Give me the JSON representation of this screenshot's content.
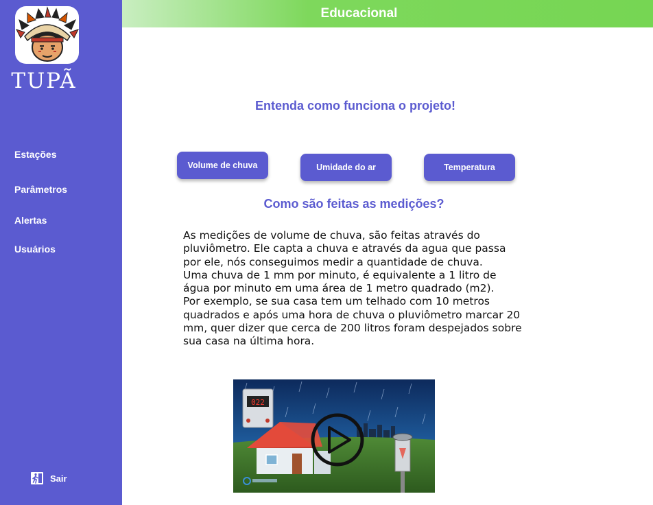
{
  "brand": {
    "name": "TUPÃ"
  },
  "sidebar": {
    "items": [
      {
        "label": "Estações"
      },
      {
        "label": "Parâmetros"
      },
      {
        "label": "Alertas"
      },
      {
        "label": "Usuários"
      }
    ],
    "logout_label": "Sair"
  },
  "header": {
    "title": "Educacional"
  },
  "main": {
    "heading": "Entenda como funciona o projeto!",
    "tabs": [
      {
        "label": "Volume de chuva"
      },
      {
        "label": "Umidade do ar"
      },
      {
        "label": "Temperatura"
      }
    ],
    "section_title": "Como são feitas as medições?",
    "paragraphs": [
      "As medições de volume de chuva, são feitas através do pluviômetro.  Ele capta a chuva e através da agua que passa por ele, nós conseguimos medir a quantidade de chuva.",
      "Uma chuva de 1 mm por minuto, é equivalente a 1 litro de água por minuto em uma área de 1 metro quadrado (m2).",
      "Por exemplo, se sua casa tem um telhado com 10 metros quadrados e após uma hora de chuva o pluviômetro marcar 20 mm, quer dizer que cerca de 200 litros foram despejados sobre sua casa na última hora."
    ],
    "video": {
      "display_value": "022"
    }
  },
  "colors": {
    "sidebar": "#5b5bd0",
    "header": "#76d653",
    "accent": "#5b5bd0"
  },
  "icons": {
    "logo": "indigenous-chief-logo-icon",
    "logout": "exit-door-icon",
    "play": "play-icon"
  }
}
